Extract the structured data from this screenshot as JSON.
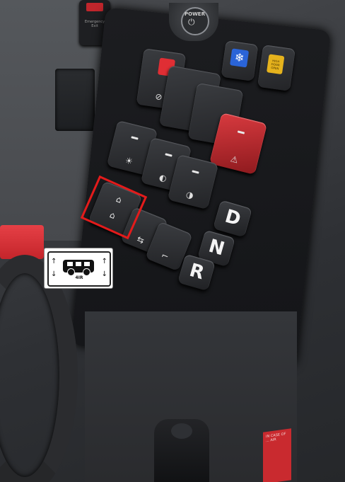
{
  "scene": {
    "description_label": "Bus dashboard switch panel with a highlighted kneeling/suspension switch",
    "top_switch_text": "Emergency Exit",
    "power_label": "POWER",
    "power_symbol": "⏻",
    "yellow_switch_text": "HIGH DOOR OPEN",
    "snowflake": "❄",
    "dash_symbol": "",
    "icons": {
      "parking_brake": "⊘",
      "hazard": "⚠",
      "interior_light": "☀",
      "headlight": "◐",
      "fog_light": "◑",
      "raise": "⌂",
      "lower": "⌂",
      "door": "⇆",
      "seat": "⌐"
    },
    "gears": [
      "D",
      "N",
      "R"
    ],
    "label_card": {
      "text": "4IR",
      "up_arrow": "↑",
      "down_arrow": "↓"
    },
    "sticker_text": "IN CASE OF ... AIR"
  }
}
